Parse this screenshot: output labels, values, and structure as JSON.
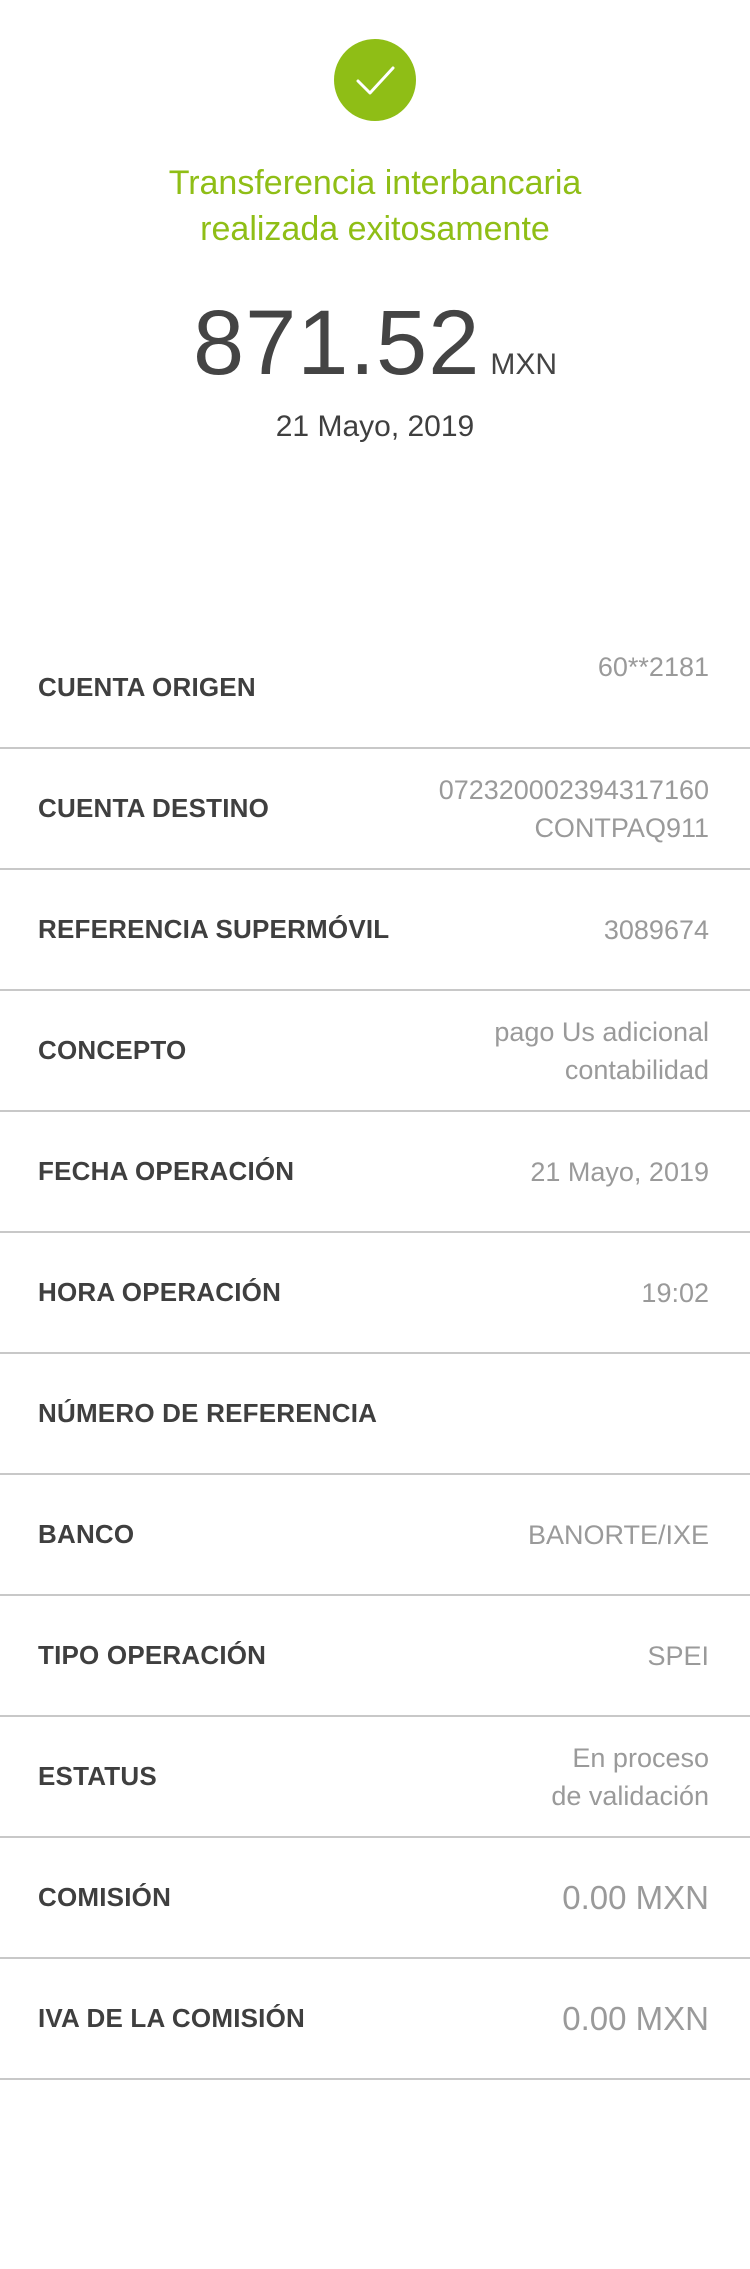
{
  "status": {
    "icon": "check-icon",
    "color": "#8fbe16",
    "title_line1": "Transferencia interbancaria",
    "title_line2": "realizada exitosamente"
  },
  "amount": {
    "value": "871.52",
    "currency": "MXN",
    "date": "21 Mayo, 2019"
  },
  "details": [
    {
      "label": "CUENTA ORIGEN",
      "value_lines": [
        "60**2181"
      ]
    },
    {
      "label": "CUENTA DESTINO",
      "value_lines": [
        "072320002394317160",
        "CONTPAQ911"
      ]
    },
    {
      "label": "REFERENCIA SUPERMÓVIL",
      "value_lines": [
        "3089674"
      ]
    },
    {
      "label": "CONCEPTO",
      "value_lines": [
        "pago Us adicional",
        "contabilidad"
      ]
    },
    {
      "label": "FECHA OPERACIÓN",
      "value_lines": [
        "21 Mayo, 2019"
      ]
    },
    {
      "label": "HORA OPERACIÓN",
      "value_lines": [
        "19:02"
      ]
    },
    {
      "label": "NÚMERO DE REFERENCIA",
      "value_lines": []
    },
    {
      "label": "BANCO",
      "value_lines": [
        "BANORTE/IXE"
      ]
    },
    {
      "label": "TIPO OPERACIÓN",
      "value_lines": [
        "SPEI"
      ]
    },
    {
      "label": "ESTATUS",
      "value_lines": [
        "En proceso",
        "de validación"
      ]
    },
    {
      "label": "COMISIÓN",
      "value_lines": [
        "0.00 MXN"
      ]
    },
    {
      "label": "IVA DE LA COMISIÓN",
      "value_lines": [
        "0.00 MXN"
      ]
    }
  ]
}
